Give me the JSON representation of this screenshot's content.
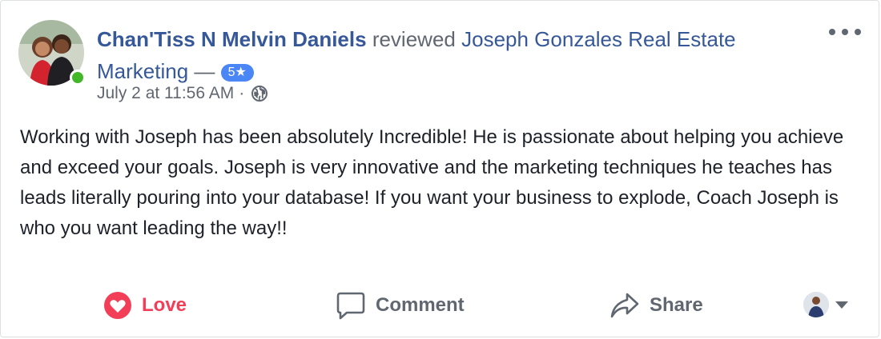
{
  "post": {
    "author": "Chan'Tiss N Melvin Daniels",
    "verb": "reviewed",
    "page_name": "Joseph Gonzales Real Estate Marketing",
    "dash": "—",
    "rating": "5",
    "rating_star": "★",
    "timestamp": "July 2 at 11:56 AM",
    "separator": "·",
    "audience_icon": "globe-icon",
    "body": "Working with Joseph has been absolutely Incredible! He is passionate about helping you achieve and exceed your goals. Joseph is very innovative and the marketing techniques he teaches has leads literally pouring into your database! If you want your business to explode, Coach Joseph is who you want leading the way!!"
  },
  "actions": {
    "love_label": "Love",
    "comment_label": "Comment",
    "share_label": "Share"
  },
  "colors": {
    "link_blue": "#365899",
    "love_red": "#f33e58",
    "rating_badge": "#4b86f7",
    "online_green": "#42b72a",
    "secondary_text": "#616770"
  }
}
